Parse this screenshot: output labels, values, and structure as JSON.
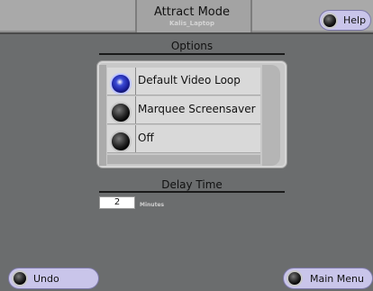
{
  "header": {
    "title": "Attract Mode",
    "subtitle": "Kalis_Laptop",
    "help_label": "Help"
  },
  "options": {
    "heading": "Options",
    "items": [
      {
        "label": "Default Video Loop",
        "selected": true
      },
      {
        "label": "Marquee Screensaver",
        "selected": false
      },
      {
        "label": "Off",
        "selected": false
      }
    ]
  },
  "delay": {
    "heading": "Delay Time",
    "value": "2",
    "unit": "Minutes"
  },
  "footer": {
    "undo_label": "Undo",
    "main_menu_label": "Main Menu"
  },
  "colors": {
    "background": "#6b6d6e",
    "button_face": "#c9c5ea",
    "selected_knob": "#2a35c2"
  }
}
